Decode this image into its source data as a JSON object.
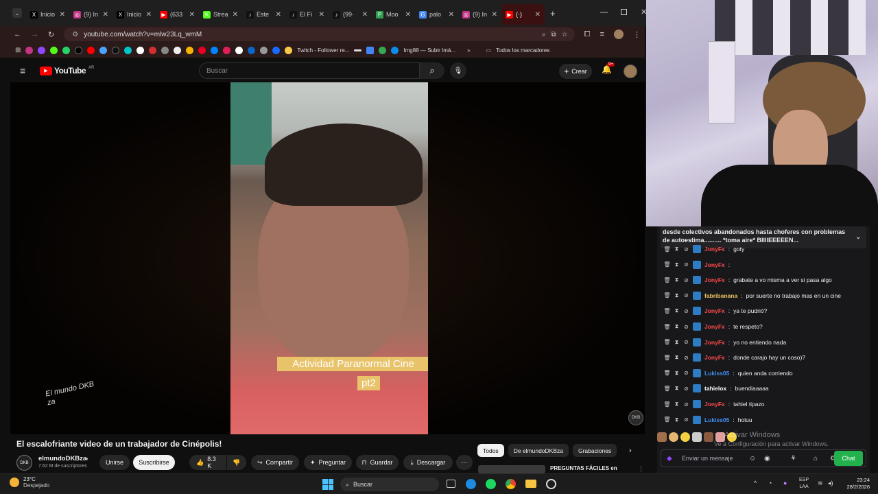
{
  "browser": {
    "tabs": [
      {
        "label": "Inicio",
        "favicon": "X",
        "color": "#000000"
      },
      {
        "label": "(9) In",
        "favicon": "◎",
        "color": "#c13584"
      },
      {
        "label": "Inicio",
        "favicon": "X",
        "color": "#000000"
      },
      {
        "label": "(633",
        "favicon": "▶",
        "color": "#ff0000"
      },
      {
        "label": "Strea",
        "favicon": "K",
        "color": "#53fc18"
      },
      {
        "label": "Este",
        "favicon": "♪",
        "color": "#111111"
      },
      {
        "label": "El Fi",
        "favicon": "♪",
        "color": "#111111"
      },
      {
        "label": "(99·",
        "favicon": "♪",
        "color": "#111111"
      },
      {
        "label": "Moo",
        "favicon": "P",
        "color": "#2e9e4f"
      },
      {
        "label": "palo",
        "favicon": "G",
        "color": "#4285f4"
      },
      {
        "label": "(9) In",
        "favicon": "◎",
        "color": "#c13584"
      },
      {
        "label": "(·)",
        "favicon": "▶",
        "color": "#ff0000"
      }
    ],
    "url": "youtube.com/watch?v=mlw23Lq_wmM",
    "bookmarks": {
      "twitch": "Twitch - Follower re...",
      "imgbb": "Img88 — Subir Imá...",
      "folders": "Todos los marcadores"
    }
  },
  "youtube": {
    "logo": "YouTube",
    "country": "AR",
    "search_placeholder": "Buscar",
    "create_label": "Crear",
    "notif_count": "9+",
    "video": {
      "caption_line1": "Actividad Paranormal Cine",
      "caption_line2": "pt2",
      "watermark": "El mundo DKB za"
    },
    "title": "El escalofriante video de un trabajador de Cinépolis!",
    "channel_name": "elmundoDKBza",
    "subscribers": "7.62 M de suscriptores",
    "join_label": "Unirse",
    "subscribe_label": "Suscribirse",
    "likes": "8.3 K",
    "share_label": "Compartir",
    "ask_label": "Preguntar",
    "save_label": "Guardar",
    "download_label": "Descargar",
    "chips": [
      "Todos",
      "De elmundoDKBza",
      "Grabaciones"
    ],
    "next_video_title": "PREGUNTAS FÁCILES en"
  },
  "chat": {
    "pinned": "desde colectivos abandonados hasta choferes con problemas de autoestima.......... *toma aire* BIIIIEEEEEN...",
    "messages": [
      {
        "user": "JonyFx",
        "text": "goty",
        "color": "#ff4a4a"
      },
      {
        "user": "JonyFx",
        "text": "",
        "color": "#ff4a4a"
      },
      {
        "user": "JonyFx",
        "text": "grabate a vo misma a ver si pasa algo",
        "color": "#ff4a4a"
      },
      {
        "user": "fabribanana",
        "text": "por suerte no trabajo mas en un cine",
        "color": "#f0c060"
      },
      {
        "user": "JonyFx",
        "text": "ya te pudrió?",
        "color": "#ff4a4a"
      },
      {
        "user": "JonyFx",
        "text": "te respeto?",
        "color": "#ff4a4a"
      },
      {
        "user": "JonyFx",
        "text": "yo no entiendo nada",
        "color": "#ff4a4a"
      },
      {
        "user": "JonyFx",
        "text": "donde carajo hay un coso)?",
        "color": "#ff4a4a"
      },
      {
        "user": "Lukiss05",
        "text": "quien anda corriendo",
        "color": "#3f8ff0"
      },
      {
        "user": "tahielox",
        "text": "buendiaaaaa",
        "color": "#ffffff"
      },
      {
        "user": "JonyFx",
        "text": "tahiel tipazo",
        "color": "#ff4a4a"
      },
      {
        "user": "Lukiss05",
        "text": "holuu",
        "color": "#3f8ff0"
      }
    ],
    "input_placeholder": "Enviar un mensaje",
    "send_label": "Chat",
    "activate_windows_1": "Activar Windows",
    "activate_windows_2": "Ve a Configuración para activar Windows."
  },
  "taskbar": {
    "temperature": "23°C",
    "weather": "Despejado",
    "search": "Buscar",
    "lang1": "ESP",
    "lang2": "LAA",
    "time": "23:24",
    "date": "28/2/2026"
  }
}
